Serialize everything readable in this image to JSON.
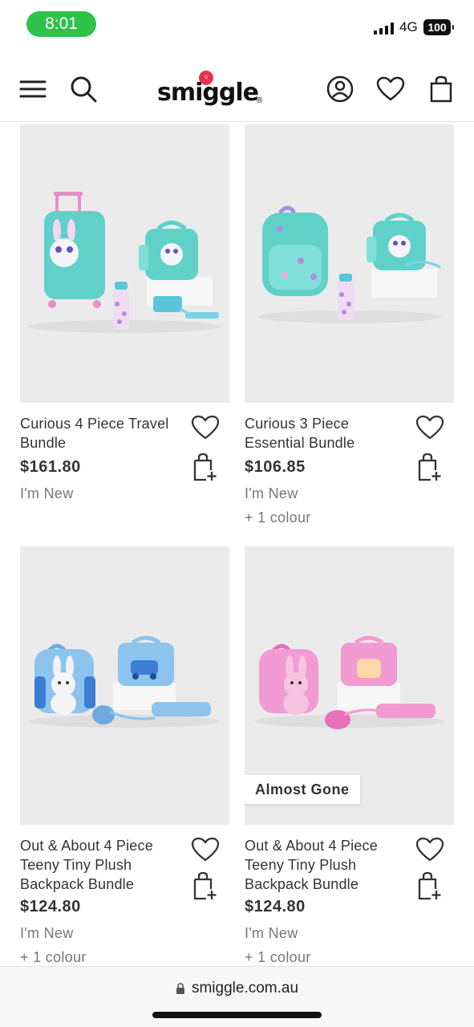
{
  "status": {
    "time": "8:01",
    "network": "4G",
    "battery": "100"
  },
  "header": {
    "logo_text": "smiggle",
    "logo_mark": "®",
    "icons": [
      "menu-icon",
      "search-icon",
      "account-icon",
      "heart-icon",
      "bag-icon"
    ]
  },
  "products": [
    {
      "name": "Curious 4 Piece Travel Bundle",
      "price": "$161.80",
      "tag": "I'm New",
      "colours": "",
      "badge": ""
    },
    {
      "name": "Curious 3 Piece Essential Bundle",
      "price": "$106.85",
      "tag": "I'm New",
      "colours": "+ 1 colour",
      "badge": ""
    },
    {
      "name": "Out & About 4 Piece Teeny Tiny Plush Backpack Bundle",
      "price": "$124.80",
      "tag": "I'm New",
      "colours": "+ 1 colour",
      "badge": ""
    },
    {
      "name": "Out & About 4 Piece Teeny Tiny Plush Backpack Bundle",
      "price": "$124.80",
      "tag": "I'm New",
      "colours": "+ 1 colour",
      "badge": "Almost Gone"
    }
  ],
  "browser": {
    "url": "smiggle.com.au"
  },
  "colors": {
    "status_green": "#2ec24a",
    "image_bg": "#ebebeb",
    "teal": "#5fd1c9",
    "blue": "#8cc4ee",
    "pink": "#f29bd2"
  }
}
